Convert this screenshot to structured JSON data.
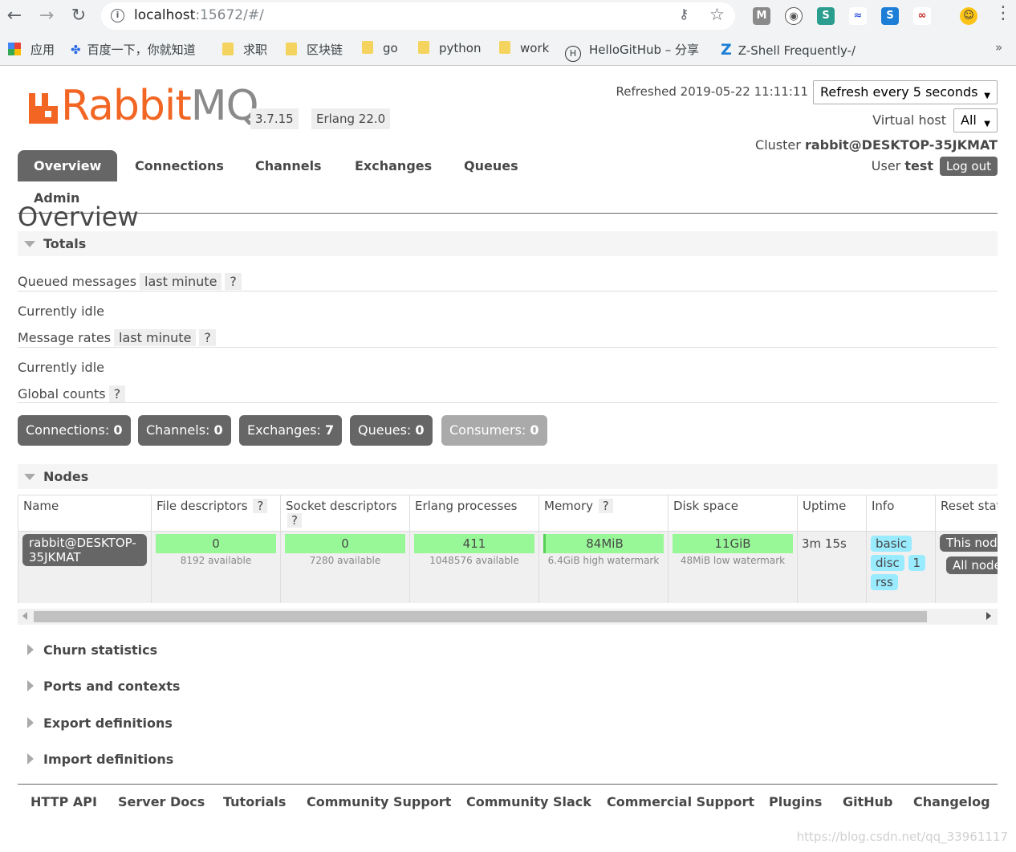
{
  "browser": {
    "url_host": "localhost",
    "url_path": ":15672/#/",
    "bookmarks": [
      "应用",
      "百度一下，你就知道",
      "求职",
      "区块链",
      "go",
      "python",
      "work",
      "HelloGitHub – 分享",
      "Z-Shell Frequently-/"
    ],
    "more": "»"
  },
  "header": {
    "logo_rabbit": "Rabbit",
    "logo_mq": "MQ",
    "logo_tm": "TM",
    "version": "3.7.15",
    "erlang": "Erlang 22.0",
    "refreshed": "Refreshed 2019-05-22 11:11:11",
    "refresh_select": "Refresh every 5 seconds",
    "vhost_label": "Virtual host",
    "vhost_select": "All",
    "cluster_prefix": "Cluster",
    "cluster_name": "rabbit@DESKTOP-35JKMAT",
    "user_prefix": "User",
    "user_name": "test",
    "logout": "Log out"
  },
  "tabs": [
    "Overview",
    "Connections",
    "Channels",
    "Exchanges",
    "Queues",
    "Admin"
  ],
  "title": "Overview",
  "totals": {
    "heading": "Totals",
    "queued_label": "Queued messages",
    "queued_period": "last minute",
    "help": "?",
    "idle1": "Currently idle",
    "rates_label": "Message rates",
    "rates_period": "last minute",
    "idle2": "Currently idle",
    "global_label": "Global counts"
  },
  "counts": [
    {
      "label": "Connections:",
      "value": "0"
    },
    {
      "label": "Channels:",
      "value": "0"
    },
    {
      "label": "Exchanges:",
      "value": "7"
    },
    {
      "label": "Queues:",
      "value": "0"
    },
    {
      "label": "Consumers:",
      "value": "0"
    }
  ],
  "nodes": {
    "heading": "Nodes",
    "columns": [
      "Name",
      "File descriptors",
      "Socket descriptors",
      "Erlang processes",
      "Memory",
      "Disk space",
      "Uptime",
      "Info",
      "Reset stats"
    ],
    "row": {
      "name": "rabbit@DESKTOP-35JKMAT",
      "fd": "0",
      "fd_sub": "8192 available",
      "sd": "0",
      "sd_sub": "7280 available",
      "ep": "411",
      "ep_sub": "1048576 available",
      "mem": "84MiB",
      "mem_sub": "6.4GiB high watermark",
      "disk": "11GiB",
      "disk_sub": "48MiB low watermark",
      "uptime": "3m 15s",
      "info": [
        "basic",
        "disc",
        "1",
        "rss"
      ],
      "reset": [
        "This node",
        "All nodes"
      ]
    }
  },
  "collapsed_sections": [
    "Churn statistics",
    "Ports and contexts",
    "Export definitions",
    "Import definitions"
  ],
  "footer": [
    "HTTP API",
    "Server Docs",
    "Tutorials",
    "Community Support",
    "Community Slack",
    "Commercial Support",
    "Plugins",
    "GitHub",
    "Changelog"
  ],
  "watermark": "https://blog.csdn.net/qq_33961117"
}
